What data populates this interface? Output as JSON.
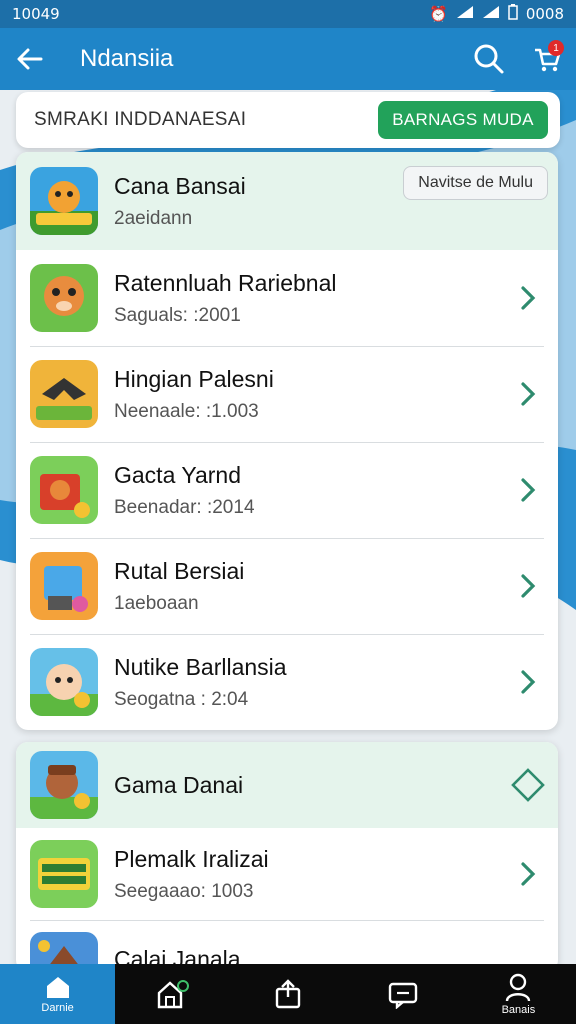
{
  "status_bar": {
    "time": "10049",
    "right_text": "0008"
  },
  "app_bar": {
    "title": "Ndansiia",
    "cart_badge": "1"
  },
  "search_card": {
    "text": "SMRAKI  INDDANAESAI",
    "button_label": "BARNAGS MUDA"
  },
  "list_card_1": {
    "header": {
      "name": "Cana Bansai",
      "sub": "2aeidann",
      "pill": "Navitse de Mulu"
    },
    "items": [
      {
        "name": "Ratennluah Rariebnal",
        "sub": "Saguals: :2001"
      },
      {
        "name": "Hingian Palesni",
        "sub": "Neenaale: :1.003"
      },
      {
        "name": "Gacta Yarnd",
        "sub": "Beenadar: :2014"
      },
      {
        "name": "Rutal Bersiai",
        "sub": "1aeboaan"
      },
      {
        "name": "Nutike Barllansia",
        "sub": "Seogatna : 2:04"
      }
    ]
  },
  "list_card_2": {
    "header": {
      "name": "Gama Danai"
    },
    "items": [
      {
        "name": "Plemalk Iralizai",
        "sub": "Seegaaao: 1003"
      },
      {
        "name": "Calai Janala",
        "sub": ""
      }
    ]
  },
  "bottom_nav": [
    {
      "label": "Darnie",
      "icon": "home-icon",
      "active": true
    },
    {
      "label": "",
      "icon": "store-icon",
      "active": false
    },
    {
      "label": "",
      "icon": "share-icon",
      "active": false
    },
    {
      "label": "",
      "icon": "chat-icon",
      "active": false
    },
    {
      "label": "Banais",
      "icon": "profile-icon",
      "active": false
    }
  ],
  "colors": {
    "primary": "#1f85c8",
    "accent_green": "#22a25a",
    "header_row_bg": "#e5f4ec",
    "chevron": "#2e8b6e"
  }
}
